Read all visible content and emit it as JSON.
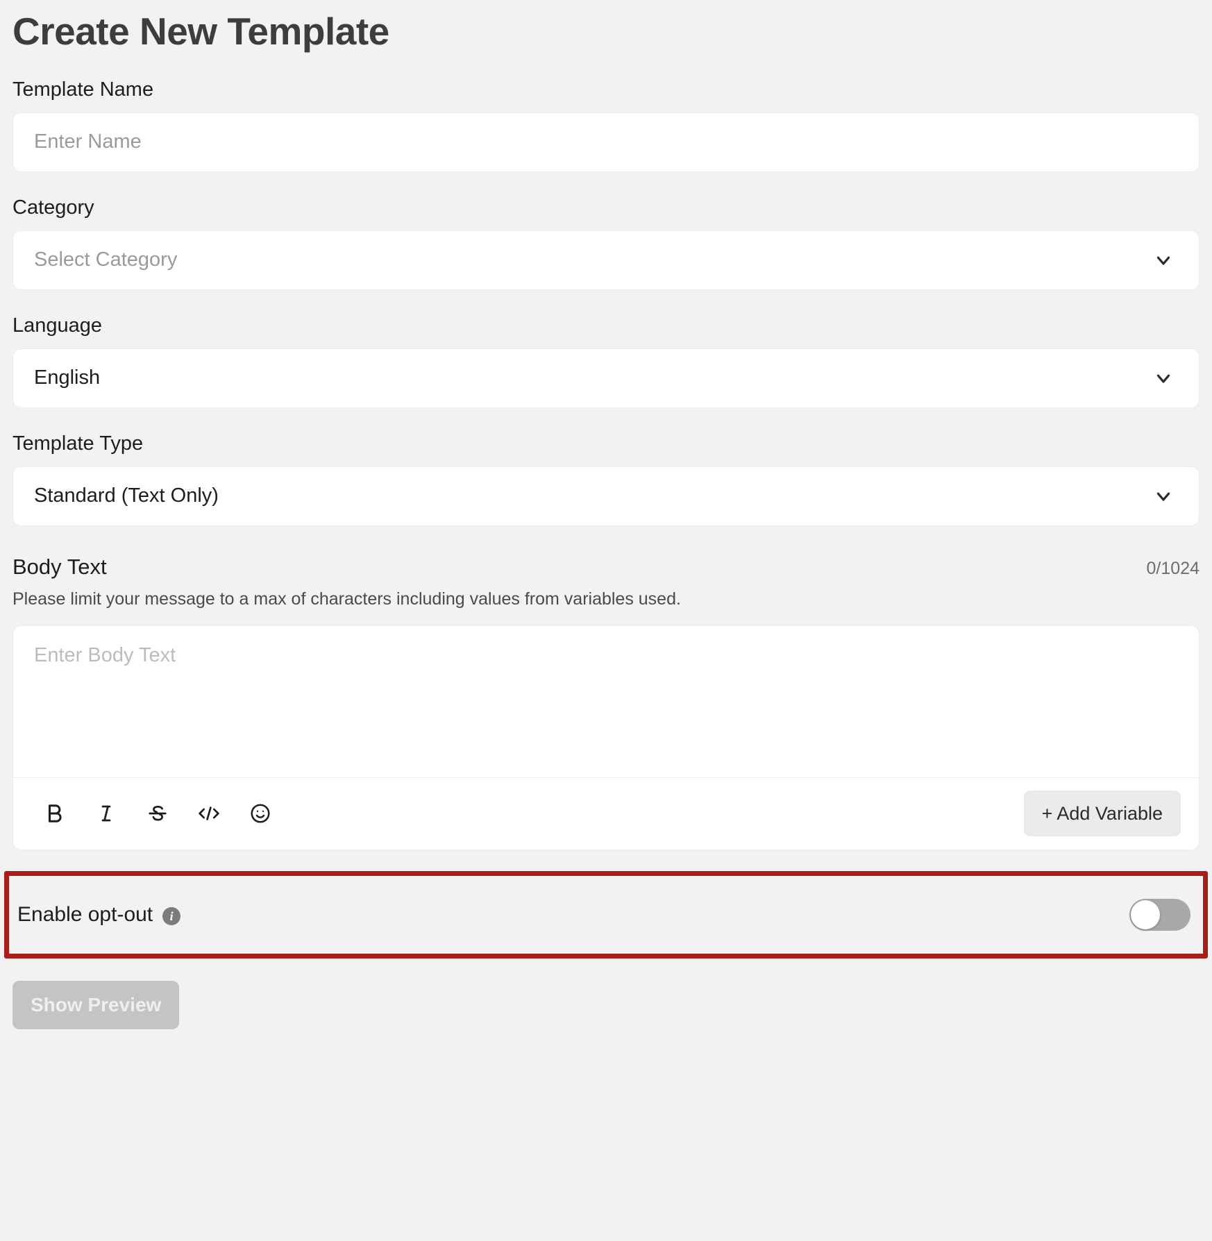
{
  "header": {
    "title": "Create New Template"
  },
  "form": {
    "template_name": {
      "label": "Template Name",
      "value": "",
      "placeholder": "Enter Name"
    },
    "category": {
      "label": "Category",
      "value": "Select Category",
      "is_placeholder": true,
      "chevron_icon": "chevron-down-icon"
    },
    "language": {
      "label": "Language",
      "value": "English",
      "is_placeholder": false,
      "chevron_icon": "chevron-down-icon"
    },
    "template_type": {
      "label": "Template Type",
      "value": "Standard (Text Only)",
      "is_placeholder": false,
      "chevron_icon": "chevron-down-icon"
    },
    "body_text": {
      "label": "Body Text",
      "char_counter": "0/1024",
      "hint": "Please limit your message to a max of characters including values from variables used.",
      "placeholder": "Enter Body Text",
      "value": ""
    }
  },
  "toolbar": {
    "tools": [
      {
        "name": "bold-icon",
        "label": "B"
      },
      {
        "name": "italic-icon",
        "label": "I"
      },
      {
        "name": "strikethrough-icon",
        "label": "S"
      },
      {
        "name": "code-icon",
        "label": "</>"
      },
      {
        "name": "emoji-icon",
        "label": "☺"
      }
    ],
    "add_variable_label": "+ Add Variable"
  },
  "optout": {
    "label": "Enable opt-out",
    "info_icon": "info-icon",
    "info_glyph": "i",
    "toggle_state": "off",
    "highlight_color": "#a71d18"
  },
  "actions": {
    "show_preview_label": "Show Preview"
  },
  "colors": {
    "page_background": "#f2f2f2",
    "field_background": "#ffffff",
    "placeholder_text": "#9a9a9a",
    "primary_text": "#1d1d1d",
    "disabled_button": "#c4c4c4",
    "toggle_track_off": "#a8a8a8",
    "highlight_border": "#a71d18"
  }
}
